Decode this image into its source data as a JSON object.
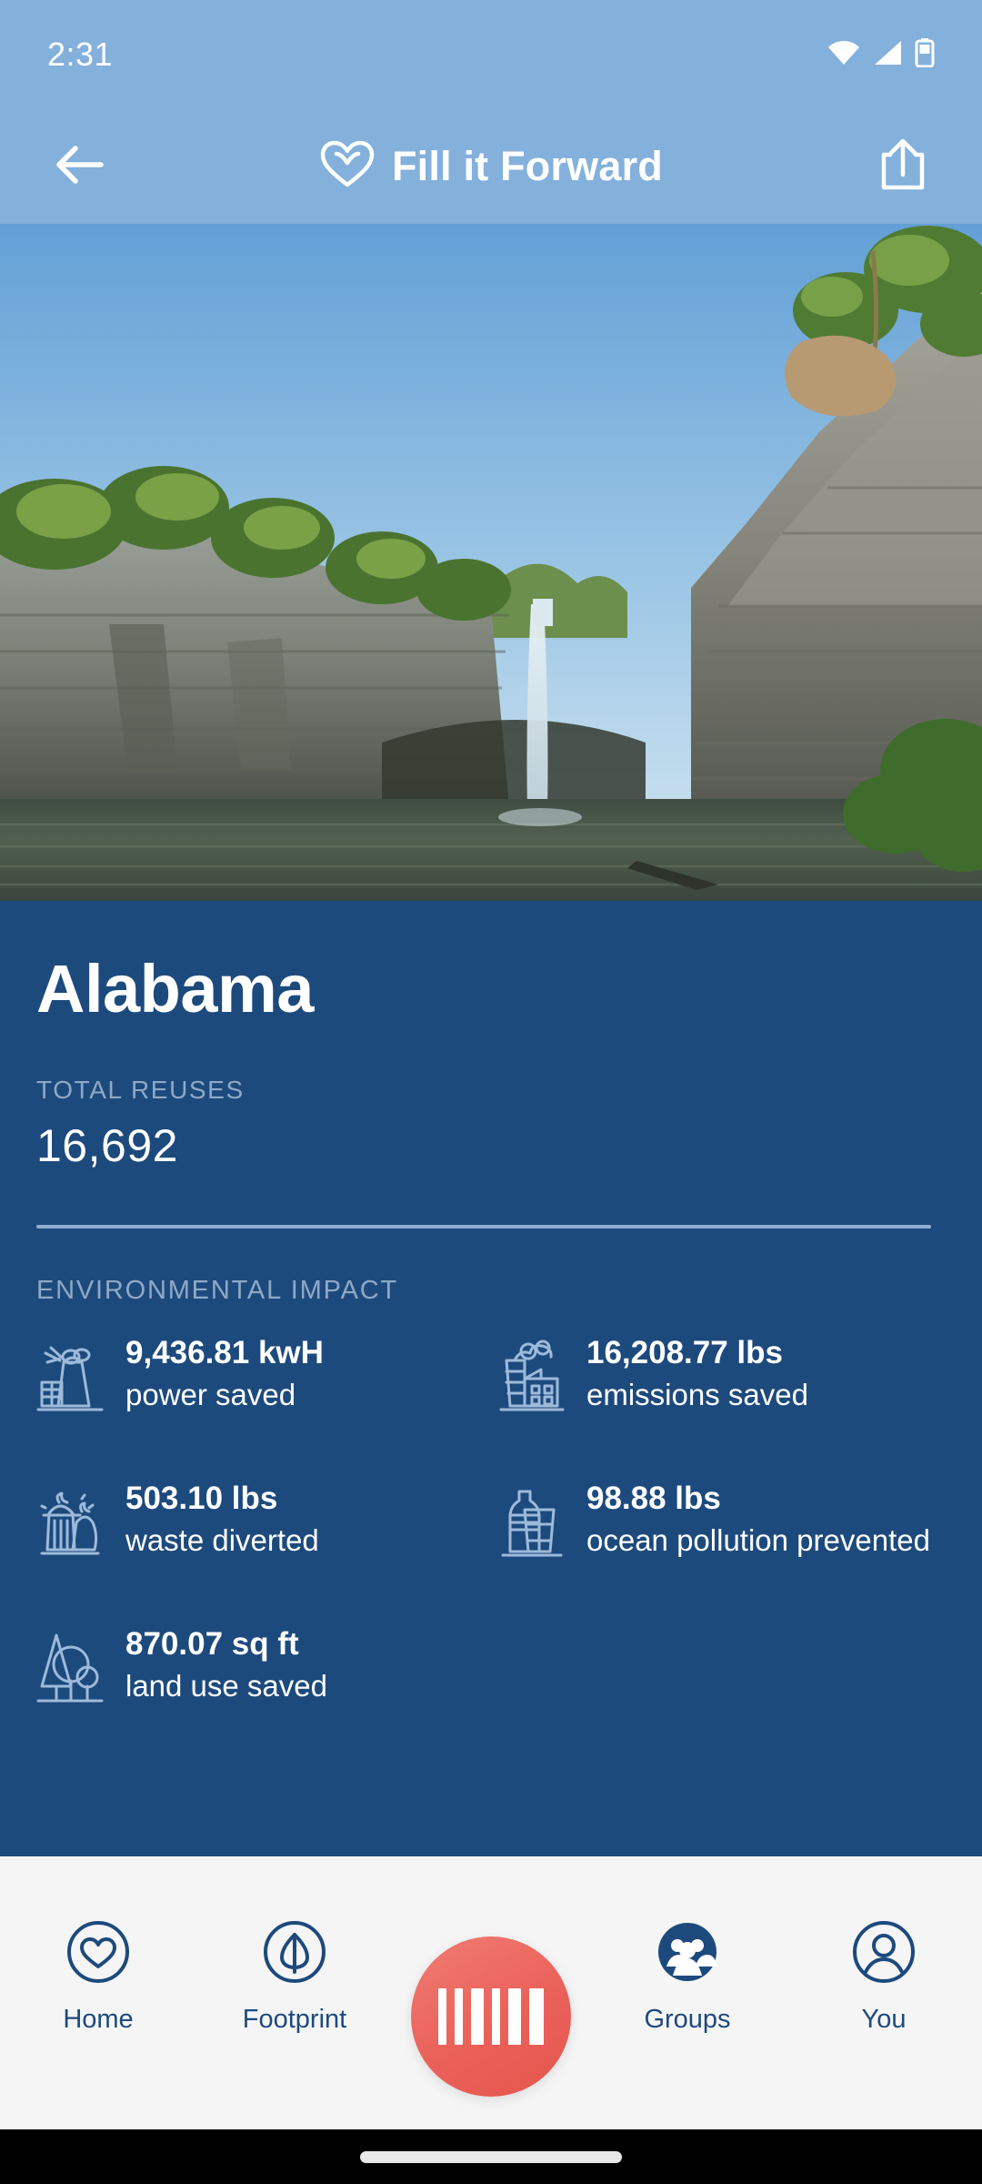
{
  "status_bar": {
    "time": "2:31",
    "icons": [
      "wifi-icon",
      "cellular-signal-icon",
      "battery-icon"
    ]
  },
  "app_bar": {
    "back_icon": "back-arrow-icon",
    "brand_logo": "heart-logo-icon",
    "brand_name": "Fill it Forward",
    "share_icon": "share-icon"
  },
  "hero": {
    "alt": "waterfall-over-limestone-cliff-photo"
  },
  "panel": {
    "state_name": "Alabama",
    "total_reuses_label": "TOTAL REUSES",
    "total_reuses_value": "16,692",
    "section_label": "ENVIRONMENTAL IMPACT",
    "stats": [
      {
        "icon": "power-plant-icon",
        "value": "9,436.81 kwH",
        "desc": "power saved"
      },
      {
        "icon": "factory-icon",
        "value": "16,208.77 lbs",
        "desc": "emissions saved"
      },
      {
        "icon": "trash-bags-icon",
        "value": "503.10 lbs",
        "desc": "waste diverted"
      },
      {
        "icon": "bottle-cup-icon",
        "value": "98.88 lbs",
        "desc": "ocean pollution prevented"
      },
      {
        "icon": "trees-icon",
        "value": "870.07 sq ft",
        "desc": "land use saved"
      }
    ]
  },
  "bottom_nav": {
    "items": [
      {
        "icon": "heart-circle-icon",
        "label": "Home"
      },
      {
        "icon": "leaf-circle-icon",
        "label": "Footprint"
      },
      {
        "icon": "people-circle-icon",
        "label": "Groups"
      },
      {
        "icon": "person-circle-icon",
        "label": "You"
      }
    ],
    "scan_button": {
      "icon": "barcode-icon"
    }
  },
  "colors": {
    "header_blue": "#84b0dc",
    "panel_blue": "#1d4a7d",
    "muted_label": "#8fa9c6",
    "scan_coral": "#ea6159",
    "nav_background": "#f5f5f5"
  }
}
